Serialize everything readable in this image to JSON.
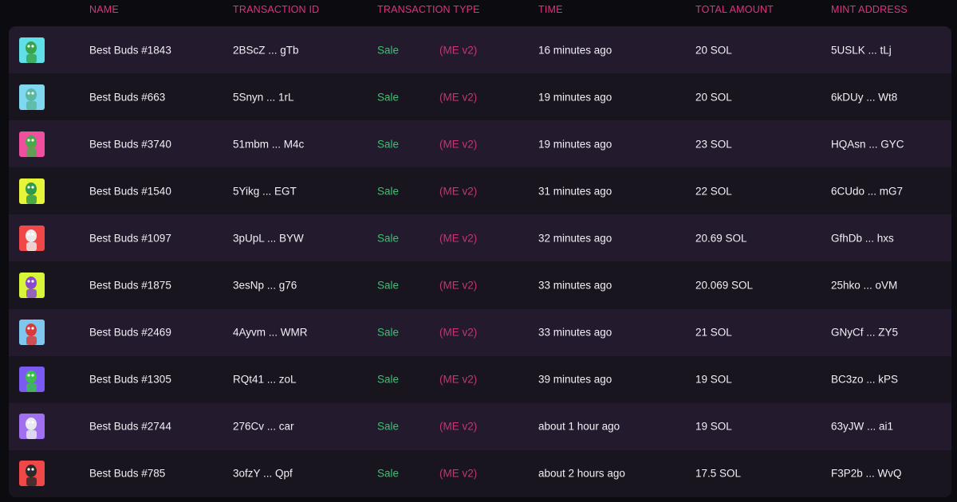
{
  "header": {
    "name": "NAME",
    "transaction_id": "TRANSACTION ID",
    "transaction_type": "TRANSACTION TYPE",
    "time": "TIME",
    "total_amount": "TOTAL AMOUNT",
    "mint_address": "MINT ADDRESS"
  },
  "colors": {
    "accent": "#e0337f",
    "sale": "#3fbf73",
    "marketplace": "#c23774",
    "row_odd": "#231a2e",
    "row_even": "#19151f",
    "background": "#0c0b10"
  },
  "rows": [
    {
      "name": "Best Buds #1843",
      "txid": "2BScZ ... gTb",
      "type": "Sale",
      "market": "(ME v2)",
      "time": "16 minutes ago",
      "amount": "20 SOL",
      "mint": "5USLK ... tLj",
      "thumb_bg": "#5fe0e8",
      "thumb_fg": "#3aa34a"
    },
    {
      "name": "Best Buds #663",
      "txid": "5Snyn ... 1rL",
      "type": "Sale",
      "market": "(ME v2)",
      "time": "19 minutes ago",
      "amount": "20 SOL",
      "mint": "6kDUy ... Wt8",
      "thumb_bg": "#7fd8f0",
      "thumb_fg": "#5ab8a0"
    },
    {
      "name": "Best Buds #3740",
      "txid": "51mbm ... M4c",
      "type": "Sale",
      "market": "(ME v2)",
      "time": "19 minutes ago",
      "amount": "23 SOL",
      "mint": "HQAsn ... GYC",
      "thumb_bg": "#f04fa0",
      "thumb_fg": "#4aa84a"
    },
    {
      "name": "Best Buds #1540",
      "txid": "5Yikg ... EGT",
      "type": "Sale",
      "market": "(ME v2)",
      "time": "31 minutes ago",
      "amount": "22 SOL",
      "mint": "6CUdo ... mG7",
      "thumb_bg": "#e6f53a",
      "thumb_fg": "#2f9a4a"
    },
    {
      "name": "Best Buds #1097",
      "txid": "3pUpL ... BYW",
      "type": "Sale",
      "market": "(ME v2)",
      "time": "32 minutes ago",
      "amount": "20.69 SOL",
      "mint": "GfhDb ... hxs",
      "thumb_bg": "#f04848",
      "thumb_fg": "#eaeaea"
    },
    {
      "name": "Best Buds #1875",
      "txid": "3esNp ... g76",
      "type": "Sale",
      "market": "(ME v2)",
      "time": "33 minutes ago",
      "amount": "20.069 SOL",
      "mint": "25hko ... oVM",
      "thumb_bg": "#d8f53a",
      "thumb_fg": "#8a4ad0"
    },
    {
      "name": "Best Buds #2469",
      "txid": "4Ayvm ... WMR",
      "type": "Sale",
      "market": "(ME v2)",
      "time": "33 minutes ago",
      "amount": "21 SOL",
      "mint": "GNyCf ... ZY5",
      "thumb_bg": "#7ec8f0",
      "thumb_fg": "#d83a3a"
    },
    {
      "name": "Best Buds #1305",
      "txid": "RQt41 ... zoL",
      "type": "Sale",
      "market": "(ME v2)",
      "time": "39 minutes ago",
      "amount": "19 SOL",
      "mint": "BC3zo ... kPS",
      "thumb_bg": "#7a5af0",
      "thumb_fg": "#3abf4a"
    },
    {
      "name": "Best Buds #2744",
      "txid": "276Cv ... car",
      "type": "Sale",
      "market": "(ME v2)",
      "time": "about 1 hour ago",
      "amount": "19 SOL",
      "mint": "63yJW ... ai1",
      "thumb_bg": "#a070f0",
      "thumb_fg": "#e8e8f0"
    },
    {
      "name": "Best Buds #785",
      "txid": "3ofzY ... Qpf",
      "type": "Sale",
      "market": "(ME v2)",
      "time": "about 2 hours ago",
      "amount": "17.5 SOL",
      "mint": "F3P2b ... WvQ",
      "thumb_bg": "#f04848",
      "thumb_fg": "#2a2a2a"
    }
  ]
}
